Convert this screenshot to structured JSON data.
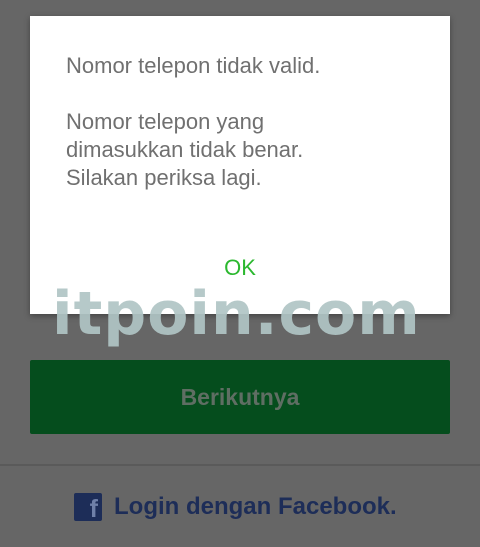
{
  "dialog": {
    "title": "Nomor telepon tidak valid.",
    "message": "Nomor telepon yang\ndimasukkan tidak benar.\nSilakan periksa lagi.",
    "ok_label": "OK"
  },
  "watermark": {
    "text": "itpoin.com"
  },
  "form": {
    "next_label": "Berikutnya"
  },
  "facebook": {
    "icon_glyph": "f",
    "label": "Login dengan Facebook."
  },
  "colors": {
    "overlay": "#666666",
    "dialog_background": "#ffffff",
    "dialog_text": "#707070",
    "ok_text": "#2bb82f",
    "next_button_bg": "#054d1d",
    "next_button_text": "#5f6e63",
    "facebook_blue": "#1d2d58",
    "watermark": "#b0c4c4"
  }
}
